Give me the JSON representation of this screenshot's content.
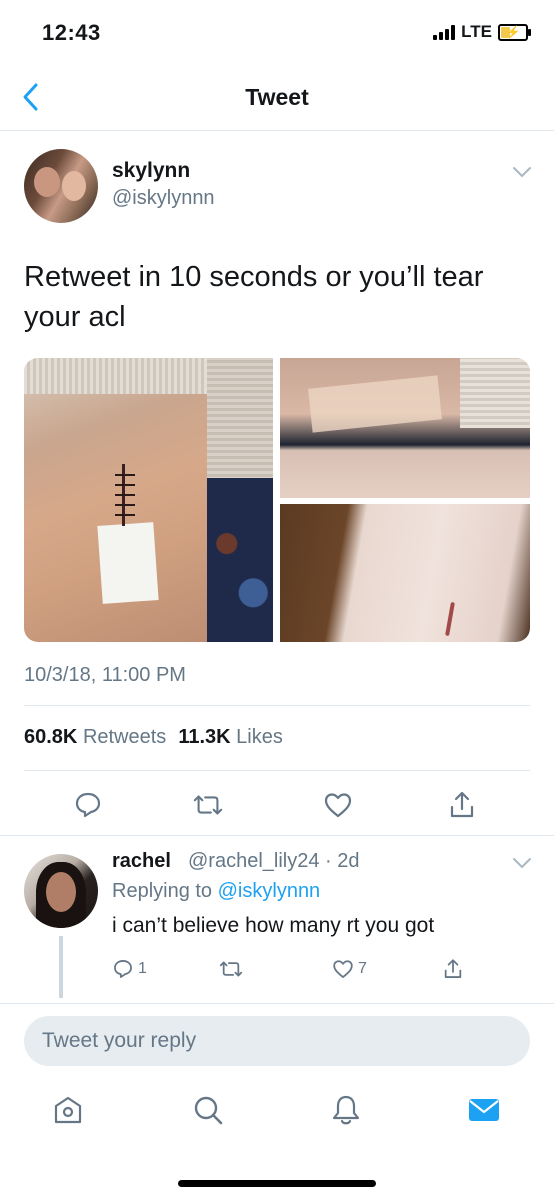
{
  "status_bar": {
    "time": "12:43",
    "network": "LTE"
  },
  "nav": {
    "title": "Tweet"
  },
  "tweet": {
    "author_name": "skylynn",
    "author_handle": "@iskylynnn",
    "text": "Retweet in 10 seconds or you’ll tear your acl",
    "timestamp": "10/3/18, 11:00 PM",
    "retweets_count": "60.8K",
    "retweets_label": "Retweets",
    "likes_count": "11.3K",
    "likes_label": "Likes"
  },
  "reply": {
    "author_name": "rachel",
    "author_handle": "@rachel_lily24 · 2d",
    "replying_prefix": "Replying to",
    "replying_to": "@iskylynnn",
    "text": "i can’t believe how many rt you got",
    "reply_count": "1",
    "like_count": "7"
  },
  "compose": {
    "placeholder": "Tweet your reply"
  },
  "colors": {
    "accent": "#1da1f2",
    "secondary_text": "#657786",
    "divider": "#e1e8ed"
  }
}
